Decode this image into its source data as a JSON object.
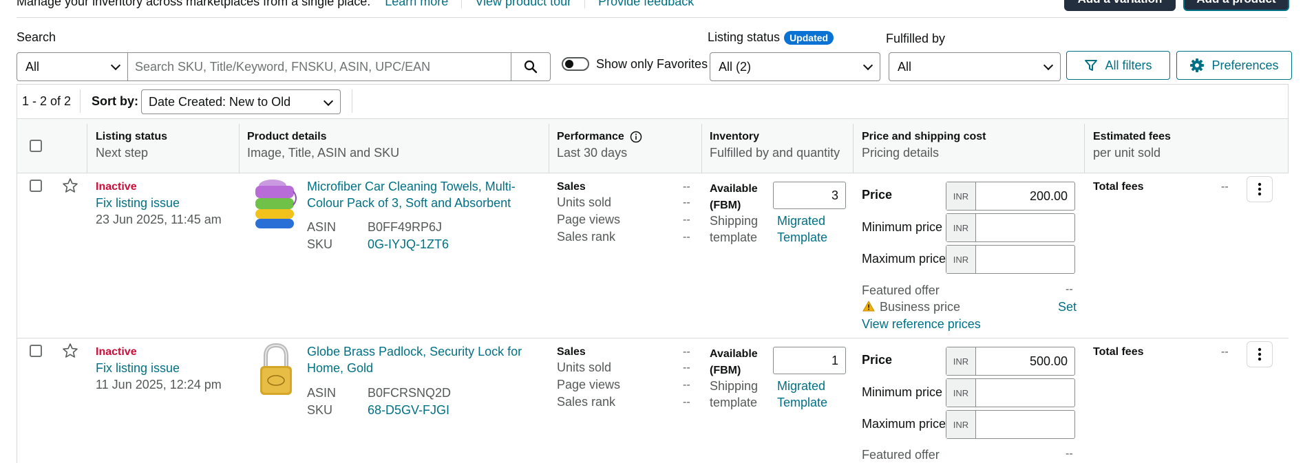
{
  "header": {
    "description": "Manage your inventory across marketplaces from a single place.",
    "links": [
      "Learn more",
      "View product tour",
      "Provide feedback"
    ],
    "add_variation": "Add a variation",
    "add_product": "Add a product"
  },
  "filters": {
    "search_label": "Search",
    "search_category": "All",
    "search_placeholder": "Search SKU, Title/Keyword, FNSKU, ASIN, UPC/EAN",
    "favorites_toggle": "Show only Favorites",
    "listing_status_label": "Listing status",
    "listing_status_badge": "Updated",
    "listing_status_value": "All (2)",
    "fulfilled_by_label": "Fulfilled by",
    "fulfilled_by_value": "All",
    "all_filters": "All filters",
    "preferences": "Preferences"
  },
  "results": {
    "count": "1 - 2 of 2",
    "sort_label": "Sort by:",
    "sort_value": "Date Created: New to Old"
  },
  "columns": [
    {
      "title": "Listing status",
      "sub": "Next step"
    },
    {
      "title": "Product details",
      "sub": "Image, Title, ASIN and SKU"
    },
    {
      "title": "Performance",
      "sub": "Last 30 days"
    },
    {
      "title": "Inventory",
      "sub": "Fulfilled by and quantity"
    },
    {
      "title": "Price and shipping cost",
      "sub": "Pricing details"
    },
    {
      "title": "Estimated fees",
      "sub": "per unit sold"
    }
  ],
  "labels": {
    "sales": "Sales",
    "units_sold": "Units sold",
    "page_views": "Page views",
    "sales_rank": "Sales rank",
    "dash": "--",
    "available_1": "Available",
    "available_2": "(FBM)",
    "shipping_1": "Shipping",
    "shipping_2": "template",
    "template_1": "Migrated",
    "template_2": "Template",
    "price": "Price",
    "min_price": "Minimum price",
    "max_price": "Maximum price",
    "currency": "INR",
    "featured_offer": "Featured offer",
    "business_price": "Business price",
    "set": "Set",
    "view_reference": "View reference prices",
    "total_fees": "Total fees",
    "asin": "ASIN",
    "sku": "SKU"
  },
  "rows": [
    {
      "status": "Inactive",
      "next_step": "Fix listing issue",
      "date": "23 Jun 2025, 11:45 am",
      "title_1": "Microfiber Car Cleaning Towels, Multi-",
      "title_2": "Colour Pack of 3, Soft and Absorbent",
      "asin": "B0FF49RP6J",
      "sku": "0G-IYJQ-1ZT6",
      "quantity": "3",
      "price": "200.00"
    },
    {
      "status": "Inactive",
      "next_step": "Fix listing issue",
      "date": "11 Jun 2025, 12:24 pm",
      "title_1": "Globe Brass Padlock, Security Lock for",
      "title_2": "Home, Gold",
      "asin": "B0FCRSNQ2D",
      "sku": "68-D5GV-FJGI",
      "quantity": "1",
      "price": "500.00"
    }
  ],
  "colors": {
    "link": "#007185",
    "inactive": "#cc0c39",
    "badge": "#0972d3",
    "dark": "#232f3e"
  }
}
